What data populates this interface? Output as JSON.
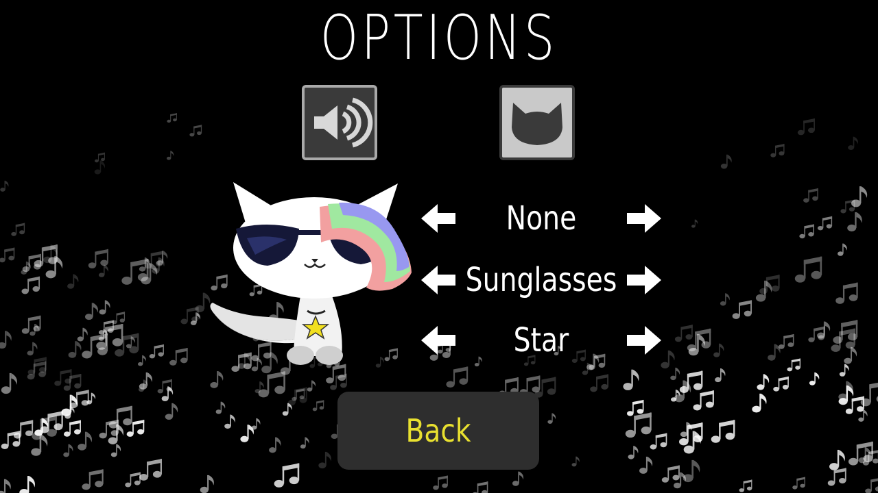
{
  "screen": {
    "title": "OPTIONS"
  },
  "tabs": [
    {
      "icon": "speaker-icon",
      "selected": false
    },
    {
      "icon": "cat-head-icon",
      "selected": true
    }
  ],
  "cat_preview": {
    "accessories": [
      "rainbow-hair",
      "sunglasses",
      "star-necklace"
    ]
  },
  "accessory_rows": {
    "hat": {
      "value": "None"
    },
    "glasses": {
      "value": "Sunglasses"
    },
    "necklace": {
      "value": "Star"
    }
  },
  "back_button": {
    "label": "Back"
  },
  "colors": {
    "background": "#000000",
    "title": "#ffffff",
    "back_label": "#e8e030",
    "back_bg": "#2e2e2e"
  }
}
